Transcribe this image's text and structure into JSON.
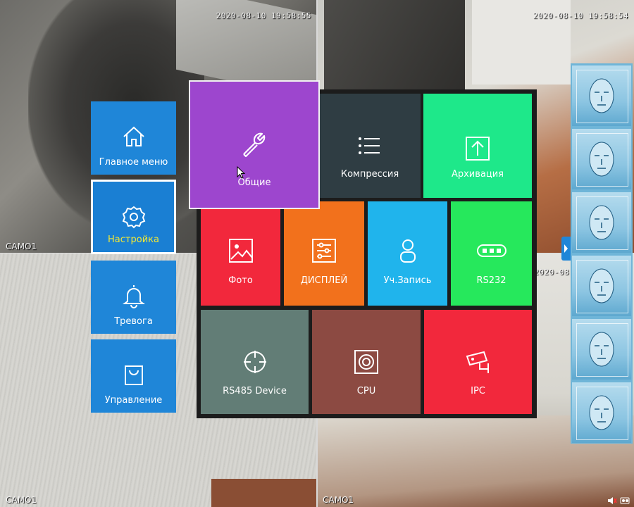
{
  "cameras": [
    {
      "timestamp": "2020-08-10  19:58:55",
      "label": "CAMO1"
    },
    {
      "timestamp": "2020-08-10  19:58:54",
      "label": ""
    },
    {
      "timestamp": "",
      "label": "CAMO1"
    },
    {
      "timestamp": "2020-08",
      "label": "CAMO1"
    }
  ],
  "sidebar": {
    "items": [
      {
        "label": "Главное меню",
        "icon": "home-icon"
      },
      {
        "label": "Настройка",
        "icon": "gear-icon",
        "active": true
      },
      {
        "label": "Тревога",
        "icon": "bell-icon"
      },
      {
        "label": "Управление",
        "icon": "bag-icon"
      }
    ]
  },
  "menu": {
    "general": {
      "label": "Общие",
      "icon": "wrench-icon",
      "color": "#9d46ce"
    },
    "tiles": [
      {
        "label": "Компрессия",
        "icon": "list-icon",
        "color": "#2f3d43"
      },
      {
        "label": "Архивация",
        "icon": "upload-icon",
        "color": "#1ee88a"
      },
      {
        "label": "Фото",
        "icon": "image-icon",
        "color": "#f2283c"
      },
      {
        "label": "ДИСПЛЕЙ",
        "icon": "sliders-icon",
        "color": "#f2711c"
      },
      {
        "label": "Уч.Запись",
        "icon": "user-icon",
        "color": "#20b4ec"
      },
      {
        "label": "RS232",
        "icon": "port-icon",
        "color": "#26e85c"
      },
      {
        "label": "RS485 Device",
        "icon": "target-icon",
        "color": "#627d76"
      },
      {
        "label": "CPU",
        "icon": "chip-icon",
        "color": "#8c4a42"
      },
      {
        "label": "IPC",
        "icon": "camera-icon",
        "color": "#f2283c"
      }
    ]
  },
  "colors": {
    "accent": "#1f86d8",
    "highlight": "#f5e932"
  }
}
